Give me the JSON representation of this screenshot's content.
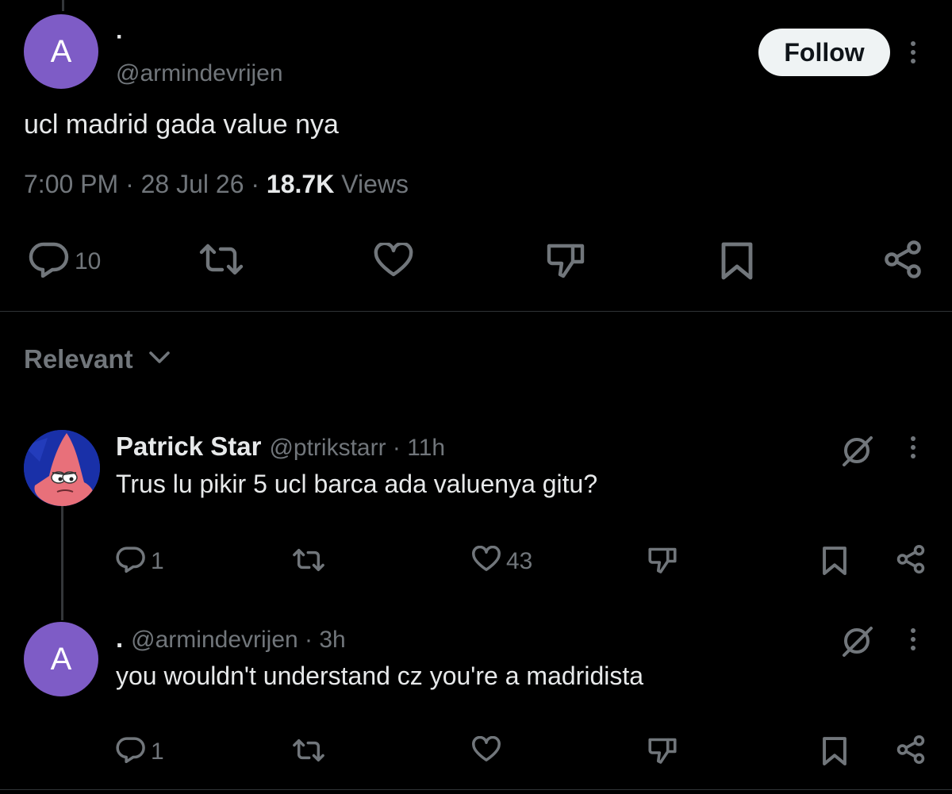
{
  "main_post": {
    "avatar_letter": "A",
    "display_name": "·",
    "handle": "@armindevrijen",
    "follow_label": "Follow",
    "text": "ucl madrid gada value nya",
    "time": "7:00 PM",
    "date": "28 Jul 26",
    "views_count": "18.7K",
    "views_label": "Views",
    "reply_count": "10"
  },
  "sort": {
    "label": "Relevant"
  },
  "replies": [
    {
      "display_name": "Patrick Star",
      "handle": "@ptrikstarr",
      "age": "11h",
      "text": "Trus lu pikir 5 ucl barca ada valuenya gitu?",
      "reply_count": "1",
      "like_count": "43"
    },
    {
      "avatar_letter": "A",
      "display_name": ".",
      "handle": "@armindevrijen",
      "age": "3h",
      "text": "you wouldn't understand cz you're a madridista",
      "reply_count": "1"
    }
  ],
  "colors": {
    "background": "#000000",
    "avatar": "#7e5cc6",
    "muted": "#71767b",
    "text": "#e7e9ea"
  }
}
